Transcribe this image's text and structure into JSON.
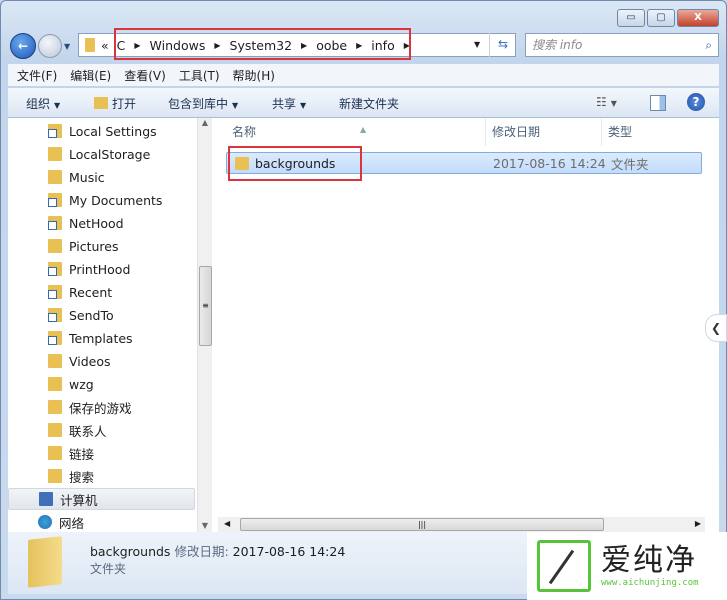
{
  "window": {
    "minimize": "▭",
    "maximize": "▢",
    "close": "X"
  },
  "address": {
    "overflow": "«",
    "crumbs": [
      "C",
      "Windows",
      "System32",
      "oobe",
      "info"
    ]
  },
  "search": {
    "placeholder": "搜索 info"
  },
  "menu": [
    "文件(F)",
    "编辑(E)",
    "查看(V)",
    "工具(T)",
    "帮助(H)"
  ],
  "toolbar": {
    "organize": "组织",
    "open": "打开",
    "include": "包含到库中",
    "share": "共享",
    "new_folder": "新建文件夹"
  },
  "nav": {
    "items": [
      {
        "label": "Local Settings",
        "icon": "folder-shortcut"
      },
      {
        "label": "LocalStorage",
        "icon": "folder"
      },
      {
        "label": "Music",
        "icon": "folder"
      },
      {
        "label": "My Documents",
        "icon": "folder-shortcut"
      },
      {
        "label": "NetHood",
        "icon": "folder-shortcut"
      },
      {
        "label": "Pictures",
        "icon": "folder"
      },
      {
        "label": "PrintHood",
        "icon": "folder-shortcut"
      },
      {
        "label": "Recent",
        "icon": "folder-shortcut"
      },
      {
        "label": "SendTo",
        "icon": "folder-shortcut"
      },
      {
        "label": "Templates",
        "icon": "folder-shortcut"
      },
      {
        "label": "Videos",
        "icon": "folder"
      },
      {
        "label": "wzg",
        "icon": "folder"
      },
      {
        "label": "保存的游戏",
        "icon": "folder"
      },
      {
        "label": "联系人",
        "icon": "folder"
      },
      {
        "label": "链接",
        "icon": "folder"
      },
      {
        "label": "搜索",
        "icon": "folder"
      }
    ],
    "computer": "计算机",
    "network": "网络"
  },
  "columns": {
    "name": "名称",
    "date": "修改日期",
    "type": "类型"
  },
  "files": [
    {
      "name": "backgrounds",
      "date": "2017-08-16 14:24",
      "type": "文件夹"
    }
  ],
  "status": {
    "name": "backgrounds",
    "date_label": "修改日期:",
    "date": "2017-08-16 14:24",
    "type": "文件夹"
  },
  "watermark": {
    "text": "爱纯净",
    "url": "www.aichunjing.com"
  },
  "colors": {
    "highlight": "#d9353a",
    "selection": "#c1dcfc"
  }
}
